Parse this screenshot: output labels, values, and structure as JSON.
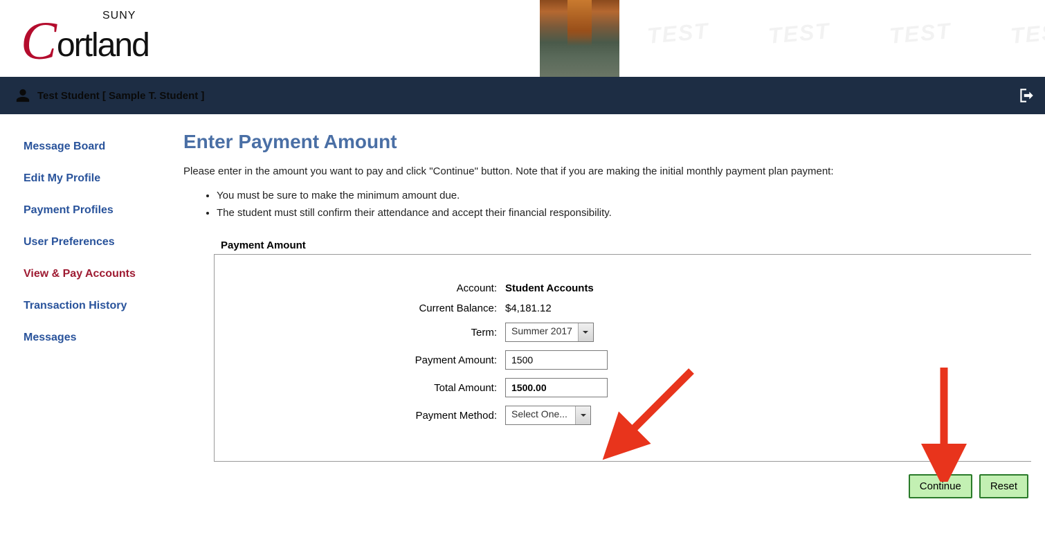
{
  "logo": {
    "institution": "Cortland",
    "supertitle": "SUNY"
  },
  "user": {
    "display_name": "Test Student [ Sample T. Student ]"
  },
  "watermark_text": "TEST",
  "sidebar": {
    "items": [
      {
        "label": "Message Board",
        "active": false
      },
      {
        "label": "Edit My Profile",
        "active": false
      },
      {
        "label": "Payment Profiles",
        "active": false
      },
      {
        "label": "User Preferences",
        "active": false
      },
      {
        "label": "View & Pay Accounts",
        "active": true
      },
      {
        "label": "Transaction History",
        "active": false
      },
      {
        "label": "Messages",
        "active": false
      }
    ]
  },
  "page": {
    "title": "Enter Payment Amount",
    "instructions": "Please enter in the amount you want to pay and click \"Continue\" button. Note that if you are making the initial monthly payment plan payment:",
    "bullets": [
      "You must be sure to make the minimum amount due.",
      "The student must still confirm their attendance and accept their financial responsibility."
    ]
  },
  "form": {
    "legend": "Payment Amount",
    "fields": {
      "account": {
        "label": "Account:",
        "value": "Student Accounts"
      },
      "current_balance": {
        "label": "Current Balance:",
        "value": "$4,181.12"
      },
      "term": {
        "label": "Term:",
        "selected": "Summer 2017"
      },
      "payment_amount": {
        "label": "Payment Amount:",
        "value": "1500"
      },
      "total_amount": {
        "label": "Total Amount:",
        "value": "1500.00"
      },
      "payment_method": {
        "label": "Payment Method:",
        "selected": "Select One..."
      }
    }
  },
  "buttons": {
    "continue": "Continue",
    "reset": "Reset"
  }
}
